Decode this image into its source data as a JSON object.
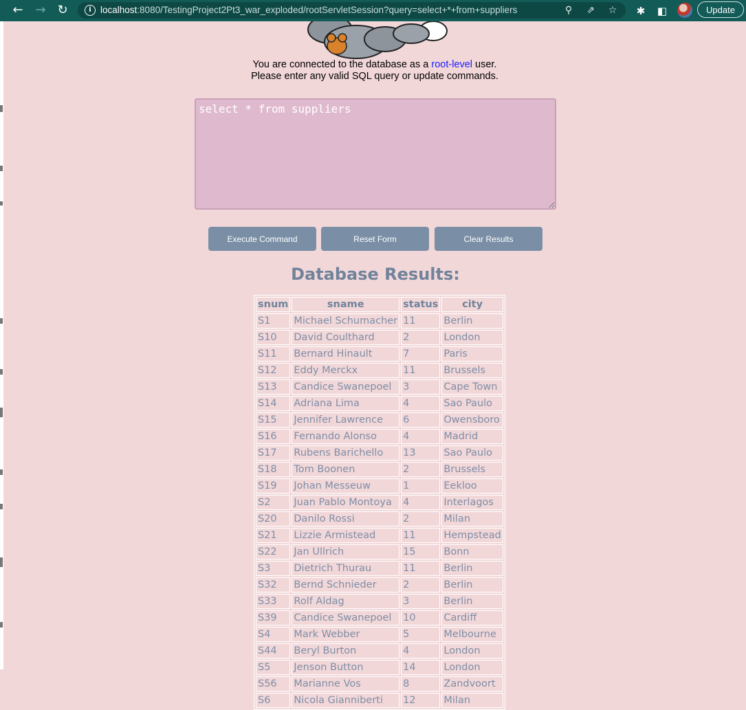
{
  "browser": {
    "url_host": "localhost",
    "url_rest": ":8080/TestingProject2Pt3_war_exploded/rootServletSession?query=select+*+from+suppliers",
    "update_label": "Update"
  },
  "page": {
    "connected_prefix": "You are connected to the database as a",
    "connected_link": "root-level",
    "connected_suffix": "user.",
    "instruction": "Please enter any valid SQL query or update commands.",
    "query_text": "select * from suppliers",
    "buttons": {
      "execute": "Execute Command",
      "reset": "Reset Form",
      "clear": "Clear Results"
    },
    "results_title": "Database Results:"
  },
  "table": {
    "headers": [
      "snum",
      "sname",
      "status",
      "city"
    ],
    "rows": [
      [
        "S1",
        "Michael Schumacher",
        "11",
        "Berlin"
      ],
      [
        "S10",
        "David Coulthard",
        "2",
        "London"
      ],
      [
        "S11",
        "Bernard Hinault",
        "7",
        "Paris"
      ],
      [
        "S12",
        "Eddy Merckx",
        "11",
        "Brussels"
      ],
      [
        "S13",
        "Candice Swanepoel",
        "3",
        "Cape Town"
      ],
      [
        "S14",
        "Adriana Lima",
        "4",
        "Sao Paulo"
      ],
      [
        "S15",
        "Jennifer Lawrence",
        "6",
        "Owensboro"
      ],
      [
        "S16",
        "Fernando Alonso",
        "4",
        "Madrid"
      ],
      [
        "S17",
        "Rubens Barichello",
        "13",
        "Sao Paulo"
      ],
      [
        "S18",
        "Tom Boonen",
        "2",
        "Brussels"
      ],
      [
        "S19",
        "Johan Messeuw",
        "1",
        "Eekloo"
      ],
      [
        "S2",
        "Juan Pablo Montoya",
        "4",
        "Interlagos"
      ],
      [
        "S20",
        "Danilo Rossi",
        "2",
        "Milan"
      ],
      [
        "S21",
        "Lizzie Armistead",
        "11",
        "Hempstead"
      ],
      [
        "S22",
        "Jan Ullrich",
        "15",
        "Bonn"
      ],
      [
        "S3",
        "Dietrich Thurau",
        "11",
        "Berlin"
      ],
      [
        "S32",
        "Bernd Schnieder",
        "2",
        "Berlin"
      ],
      [
        "S33",
        "Rolf Aldag",
        "3",
        "Berlin"
      ],
      [
        "S39",
        "Candice Swanepoel",
        "10",
        "Cardiff"
      ],
      [
        "S4",
        "Mark Webber",
        "5",
        "Melbourne"
      ],
      [
        "S44",
        "Beryl Burton",
        "4",
        "London"
      ],
      [
        "S5",
        "Jenson Button",
        "14",
        "London"
      ],
      [
        "S56",
        "Marianne Vos",
        "8",
        "Zandvoort"
      ],
      [
        "S6",
        "Nicola Gianniberti",
        "12",
        "Milan"
      ]
    ]
  },
  "icons": {
    "back": "arrow-left-icon",
    "forward": "arrow-right-icon",
    "reload": "reload-icon",
    "info": "info-icon",
    "zoom": "zoom-icon",
    "share": "share-icon",
    "star": "star-icon",
    "extensions": "puzzle-icon",
    "sidepanel": "side-panel-icon"
  }
}
